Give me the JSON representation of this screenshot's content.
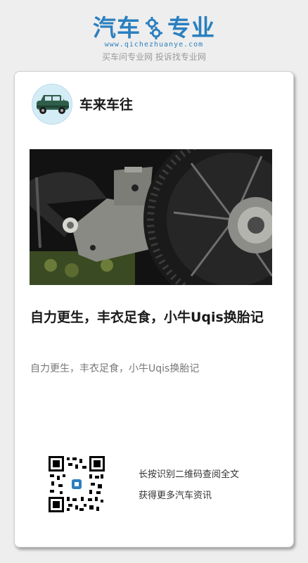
{
  "brand": {
    "logo_left": "汽车",
    "logo_right": "专业",
    "url": "www.qichezhuanye.com",
    "slogan": "买车问专业网 投诉找专业网",
    "accent": "#2b7fbf"
  },
  "card": {
    "author": "车来车往",
    "avatar_icon": "car-icon",
    "title": "自力更生，丰衣足食，小牛Uqis换胎记",
    "summary": "自力更生，丰衣足食，小牛Uqis换胎记",
    "qr_line1": "长按识别二维码查阅全文",
    "qr_line2": "获得更多汽车资讯"
  }
}
